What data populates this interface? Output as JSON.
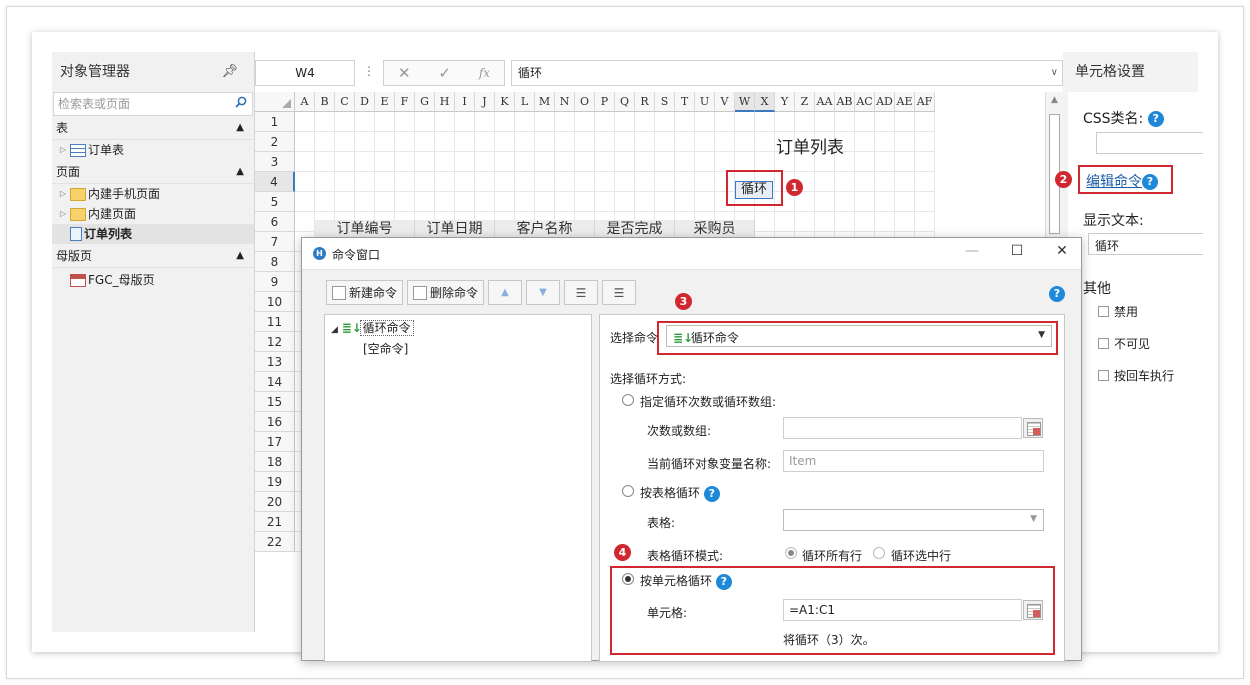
{
  "object_manager": {
    "title": "对象管理器",
    "search_placeholder": "检索表或页面",
    "sections": {
      "table": {
        "label": "表",
        "items": [
          "订单表"
        ]
      },
      "page": {
        "label": "页面",
        "items": [
          "内建手机页面",
          "内建页面",
          "订单列表"
        ]
      },
      "master": {
        "label": "母版页",
        "items": [
          "FGC_母版页"
        ]
      }
    }
  },
  "formula_bar": {
    "name_box": "W4",
    "value": "循环"
  },
  "grid": {
    "columns": [
      "A",
      "B",
      "C",
      "D",
      "E",
      "F",
      "G",
      "H",
      "I",
      "J",
      "K",
      "L",
      "M",
      "N",
      "O",
      "P",
      "Q",
      "R",
      "S",
      "T",
      "U",
      "V",
      "W",
      "X",
      "Y",
      "Z",
      "AA",
      "AB",
      "AC",
      "AD",
      "AE",
      "AF"
    ],
    "rows": [
      "1",
      "2",
      "3",
      "4",
      "5",
      "6",
      "7",
      "8",
      "9",
      "10",
      "11",
      "12",
      "13",
      "14",
      "15",
      "16",
      "17",
      "18",
      "19",
      "20",
      "21",
      "22"
    ],
    "title": "订单列表",
    "loop_cell": "循环",
    "headers": [
      "订单编号",
      "订单日期",
      "客户名称",
      "是否完成",
      "采购员"
    ]
  },
  "settings": {
    "title": "单元格设置",
    "css_label": "CSS类名:",
    "edit_command": "编辑命令",
    "display_text_label": "显示文本:",
    "display_text_value": "循环",
    "other_label": "其他",
    "checkboxes": [
      "禁用",
      "不可见",
      "按回车执行"
    ]
  },
  "badges": [
    "1",
    "2",
    "3",
    "4"
  ],
  "dialog": {
    "title": "命令窗口",
    "new_command": "新建命令",
    "delete_command": "删除命令",
    "tree": {
      "root": "循环命令",
      "child": "[空命令]"
    },
    "select_command_label": "选择命令",
    "select_command_value": "循环命令",
    "loop_method_label": "选择循环方式:",
    "option_count": "指定循环次数或循环数组:",
    "count_label": "次数或数组:",
    "var_label": "当前循环对象变量名称:",
    "var_placeholder": "Item",
    "option_table": "按表格循环",
    "table_label": "表格:",
    "table_mode_label": "表格循环模式:",
    "mode_all": "循环所有行",
    "mode_selected": "循环选中行",
    "option_cell": "按单元格循环",
    "cell_label": "单元格:",
    "cell_value": "=A1:C1",
    "loop_summary": "将循环（3）次。"
  },
  "colors": {
    "accent": "#1e88d9",
    "highlight": "#d0282e"
  }
}
